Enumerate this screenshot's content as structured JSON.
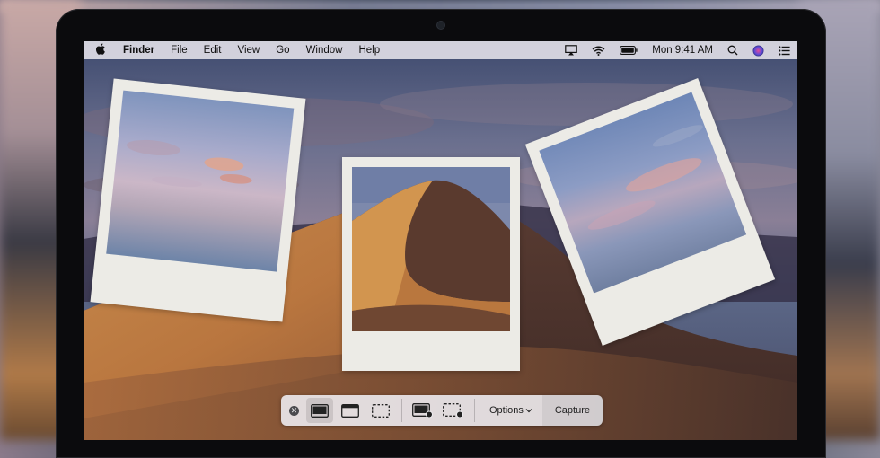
{
  "menubar": {
    "apple_icon": "apple-logo-icon",
    "app_name": "Finder",
    "menus": [
      "File",
      "Edit",
      "View",
      "Go",
      "Window",
      "Help"
    ],
    "status_icons": [
      "airplay-icon",
      "wifi-icon",
      "battery-icon"
    ],
    "clock": "Mon 9:41 AM",
    "right_icons": [
      "spotlight-search-icon",
      "siri-icon",
      "notification-center-icon"
    ]
  },
  "screenshot_toolbar": {
    "close_icon": "close-icon",
    "capture_modes": [
      {
        "icon": "capture-entire-screen-icon",
        "active": true
      },
      {
        "icon": "capture-window-icon",
        "active": false
      },
      {
        "icon": "capture-selection-icon",
        "active": false
      }
    ],
    "record_modes": [
      {
        "icon": "record-entire-screen-icon"
      },
      {
        "icon": "record-selection-icon"
      }
    ],
    "options_label": "Options",
    "options_chevron": "chevron-down-icon",
    "capture_label": "Capture"
  },
  "colors": {
    "bezel": "#0b0b0d",
    "menubar": "#e6e4eb",
    "polaroid_frame": "#ecebe6",
    "dune_light": "#d49a52",
    "dune_dark": "#6a4530"
  }
}
